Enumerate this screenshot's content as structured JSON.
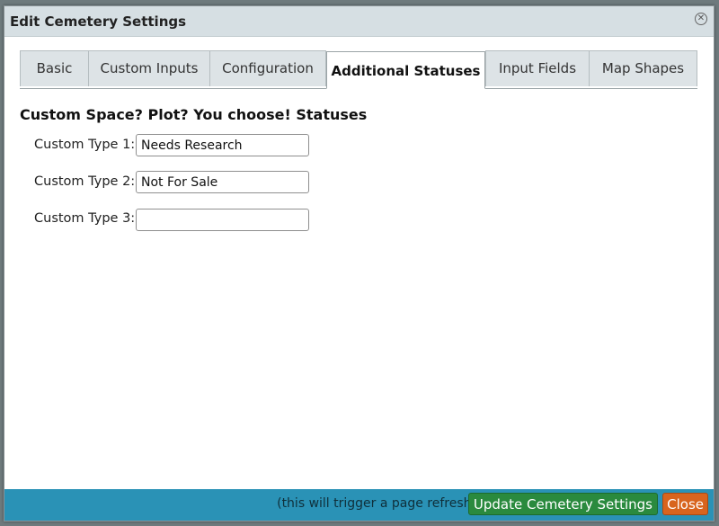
{
  "dialog": {
    "title": "Edit Cemetery Settings",
    "close_icon": "close-circle-icon"
  },
  "tabs": [
    {
      "label": "Basic",
      "active": false
    },
    {
      "label": "Custom Inputs",
      "active": false
    },
    {
      "label": "Configuration",
      "active": false
    },
    {
      "label": "Additional Statuses",
      "active": true
    },
    {
      "label": "Input Fields",
      "active": false
    },
    {
      "label": "Map Shapes",
      "active": false
    }
  ],
  "section": {
    "title": "Custom Space? Plot? You choose! Statuses"
  },
  "fields": [
    {
      "label": "Custom Type 1:",
      "value": "Needs Research"
    },
    {
      "label": "Custom Type 2:",
      "value": "Not For Sale"
    },
    {
      "label": "Custom Type 3:",
      "value": ""
    }
  ],
  "footer": {
    "note": "(this will trigger a page refresh)",
    "update_label": "Update Cemetery Settings",
    "close_label": "Close"
  },
  "colors": {
    "footer_bar": "#2a92b6",
    "update_button": "#2a8a3e",
    "close_button": "#d8641e",
    "titlebar": "#d6dfe3"
  }
}
